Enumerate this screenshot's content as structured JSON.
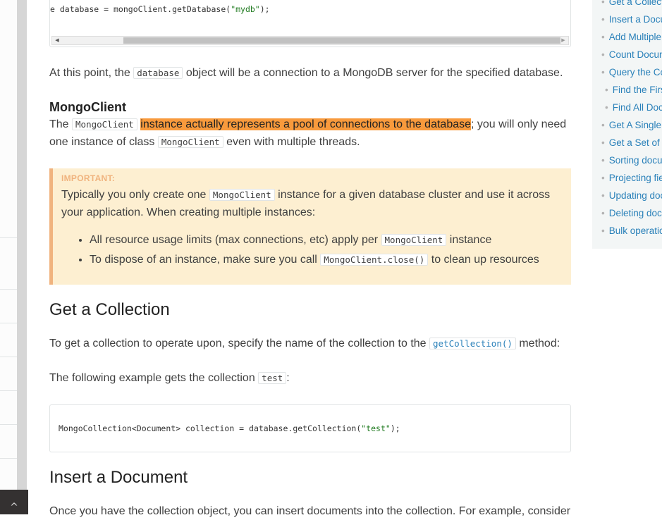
{
  "code_top": {
    "prefix": "e database = mongoClient.getDatabase(",
    "string": "\"mydb\"",
    "suffix": ");"
  },
  "para_database": {
    "before": "At this point, the ",
    "code": "database",
    "after": " object will be a connection to a MongoDB server for the specified database."
  },
  "mongoclient_section": {
    "heading": "MongoClient",
    "text_before": "The ",
    "code1": "MongoClient",
    "highlight": "instance actually represents a pool of connections to the database",
    "text_mid": "; you will only need",
    "line2_before": "one instance of class ",
    "code2": "MongoClient",
    "line2_after": " even with multiple threads."
  },
  "important": {
    "title": "IMPORTANT:",
    "body_before": "Typically you only create one ",
    "body_code": "MongoClient",
    "body_after": " instance for a given database cluster and use it across",
    "body_line2": "your application. When creating multiple instances:",
    "bullets": [
      {
        "before": "All resource usage limits (max connections, etc) apply per ",
        "code": "MongoClient",
        "after": " instance"
      },
      {
        "before": "To dispose of an instance, make sure you call ",
        "code": "MongoClient.close()",
        "after": " to clean up resources"
      }
    ]
  },
  "get_collection": {
    "heading": "Get a Collection",
    "para1_before": "To get a collection to operate upon, specify the name of the collection to the ",
    "para1_code": "getCollection()",
    "para1_after": " method:",
    "para2_before": "The following example gets the collection ",
    "para2_code": "test",
    "para2_after": ":",
    "code_prefix": "MongoCollection<Document> collection = database.getCollection(",
    "code_string": "\"test\"",
    "code_suffix": ");"
  },
  "insert_document": {
    "heading": "Insert a Document",
    "para": "Once you have the collection object, you can insert documents into the collection. For example, consider"
  },
  "toc": [
    {
      "label": "Get a Collect"
    },
    {
      "label": "Insert a Docu"
    },
    {
      "label": "Add Multiple"
    },
    {
      "label": "Count Docum"
    },
    {
      "label": "Query the Co"
    },
    {
      "label": "Find the Firs"
    },
    {
      "label": "Find All Doc"
    },
    {
      "label": "Get A Single"
    },
    {
      "label": "Get a Set of"
    },
    {
      "label": "Sorting docu"
    },
    {
      "label": "Projecting fie"
    },
    {
      "label": "Updating doc"
    },
    {
      "label": "Deleting docu"
    },
    {
      "label": "Bulk operatic"
    }
  ],
  "icons": {
    "scroll_up": "chevron-up-icon"
  },
  "colors": {
    "link": "#2980b9",
    "highlight": "#f89a3c",
    "important_bg": "#fdefd1",
    "important_accent": "#f0b37e"
  }
}
